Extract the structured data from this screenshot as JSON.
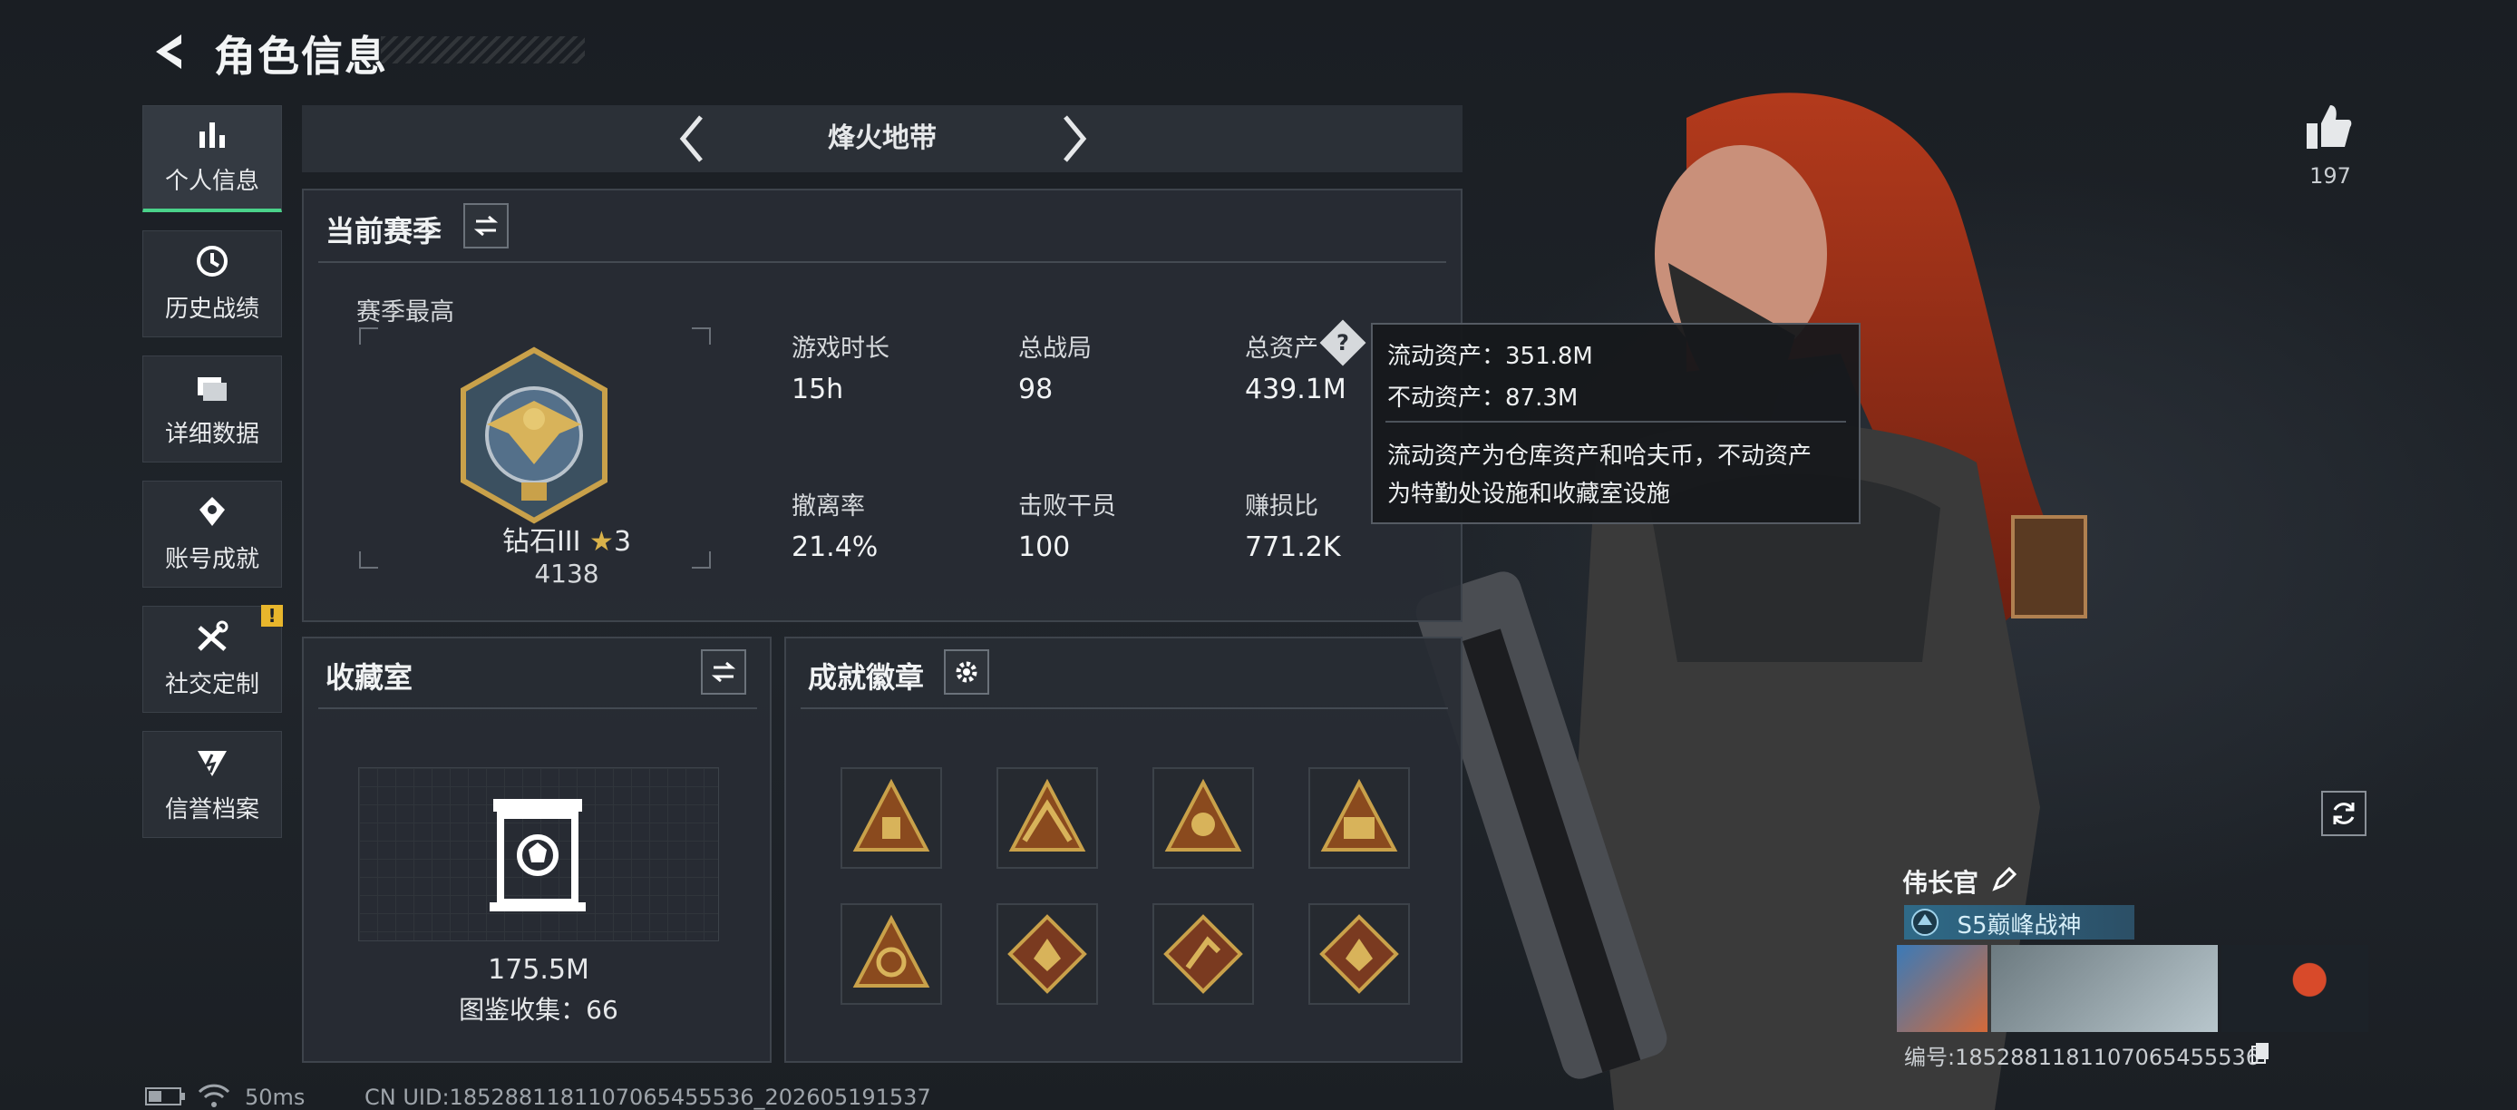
{
  "header": {
    "title": "角色信息"
  },
  "nav": [
    {
      "label": "个人信息",
      "icon": "bar-chart-icon",
      "active": true
    },
    {
      "label": "历史战绩",
      "icon": "history-icon"
    },
    {
      "label": "详细数据",
      "icon": "folder-icon"
    },
    {
      "label": "账号成就",
      "icon": "achievement-icon"
    },
    {
      "label": "社交定制",
      "icon": "tools-icon",
      "badge": "!"
    },
    {
      "label": "信誉档案",
      "icon": "shield-icon"
    }
  ],
  "mode_selector": {
    "current": "烽火地带"
  },
  "season": {
    "title": "当前赛季",
    "best_label": "赛季最高",
    "rank_name": "钻石III",
    "rank_stars": "3",
    "rank_points": "4138",
    "stats": [
      {
        "label": "游戏时长",
        "value": "15h"
      },
      {
        "label": "总战局",
        "value": "98"
      },
      {
        "label": "总资产",
        "value": "439.1M",
        "help": "?"
      },
      {
        "label": "撤离率",
        "value": "21.4%"
      },
      {
        "label": "击败干员",
        "value": "100"
      },
      {
        "label": "赚损比",
        "value": "771.2K"
      }
    ]
  },
  "tooltip": {
    "line1": "流动资产：351.8M",
    "line2": "不动资产：87.3M",
    "desc1": "流动资产为仓库资产和哈夫币，不动资产",
    "desc2": "为特勤处设施和收藏室设施"
  },
  "collection": {
    "title": "收藏室",
    "value": "175.5M",
    "count_label": "图鉴收集：66"
  },
  "achievements": {
    "title": "成就徽章",
    "badges": [
      "badge-1",
      "badge-2",
      "badge-3",
      "badge-4",
      "badge-5",
      "badge-6",
      "badge-7",
      "badge-8"
    ]
  },
  "likes": {
    "count": "197"
  },
  "player": {
    "name": "伟长官",
    "title": "S5巅峰战神",
    "id_label": "编号:1852881181107065455536"
  },
  "status_bar": {
    "ping": "50ms",
    "uid": "CN UID:1852881181107065455536_202605191537"
  },
  "colors": {
    "accent": "#4ad28a",
    "warning": "#e8b62c",
    "gold": "#c9a14a"
  }
}
